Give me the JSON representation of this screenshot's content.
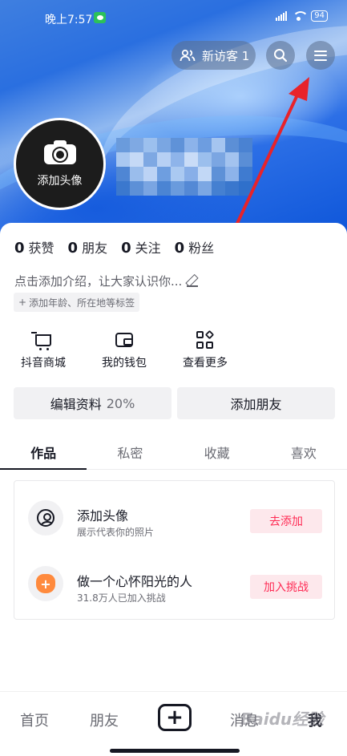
{
  "status_bar": {
    "time": "晚上7:57",
    "battery": "94"
  },
  "header": {
    "visitor_label": "新访客 1",
    "avatar_label": "添加头像"
  },
  "profile": {
    "stats": [
      {
        "value": "0",
        "label": "获赞"
      },
      {
        "value": "0",
        "label": "朋友"
      },
      {
        "value": "0",
        "label": "关注"
      },
      {
        "value": "0",
        "label": "粉丝"
      }
    ],
    "bio_placeholder": "点击添加介绍，让大家认识你...",
    "tag_prompt": "添加年龄、所在地等标签"
  },
  "shortcuts": [
    {
      "label": "抖音商城",
      "icon": "cart-icon"
    },
    {
      "label": "我的钱包",
      "icon": "wallet-icon"
    },
    {
      "label": "查看更多",
      "icon": "more-grid-icon"
    }
  ],
  "actions": {
    "edit_profile": "编辑资料",
    "edit_progress": "20%",
    "add_friend": "添加朋友"
  },
  "tabs": [
    "作品",
    "私密",
    "收藏",
    "喜欢"
  ],
  "tasks": [
    {
      "title": "添加头像",
      "subtitle": "展示代表你的照片",
      "button": "去添加",
      "icon": "user-icon"
    },
    {
      "title": "做一个心怀阳光的人",
      "subtitle": "31.8万人已加入挑战",
      "button": "加入挑战",
      "icon": "sun-badge-icon"
    }
  ],
  "bottom_nav": {
    "home": "首页",
    "friends": "朋友",
    "messages": "消息",
    "me": "我"
  },
  "watermark": "Baidu经验",
  "colors": {
    "accent": "#fe2c55",
    "accent_bg": "#fde8ec",
    "hero_blue": "#2a6fe0",
    "annotation_arrow": "#e8232a"
  }
}
